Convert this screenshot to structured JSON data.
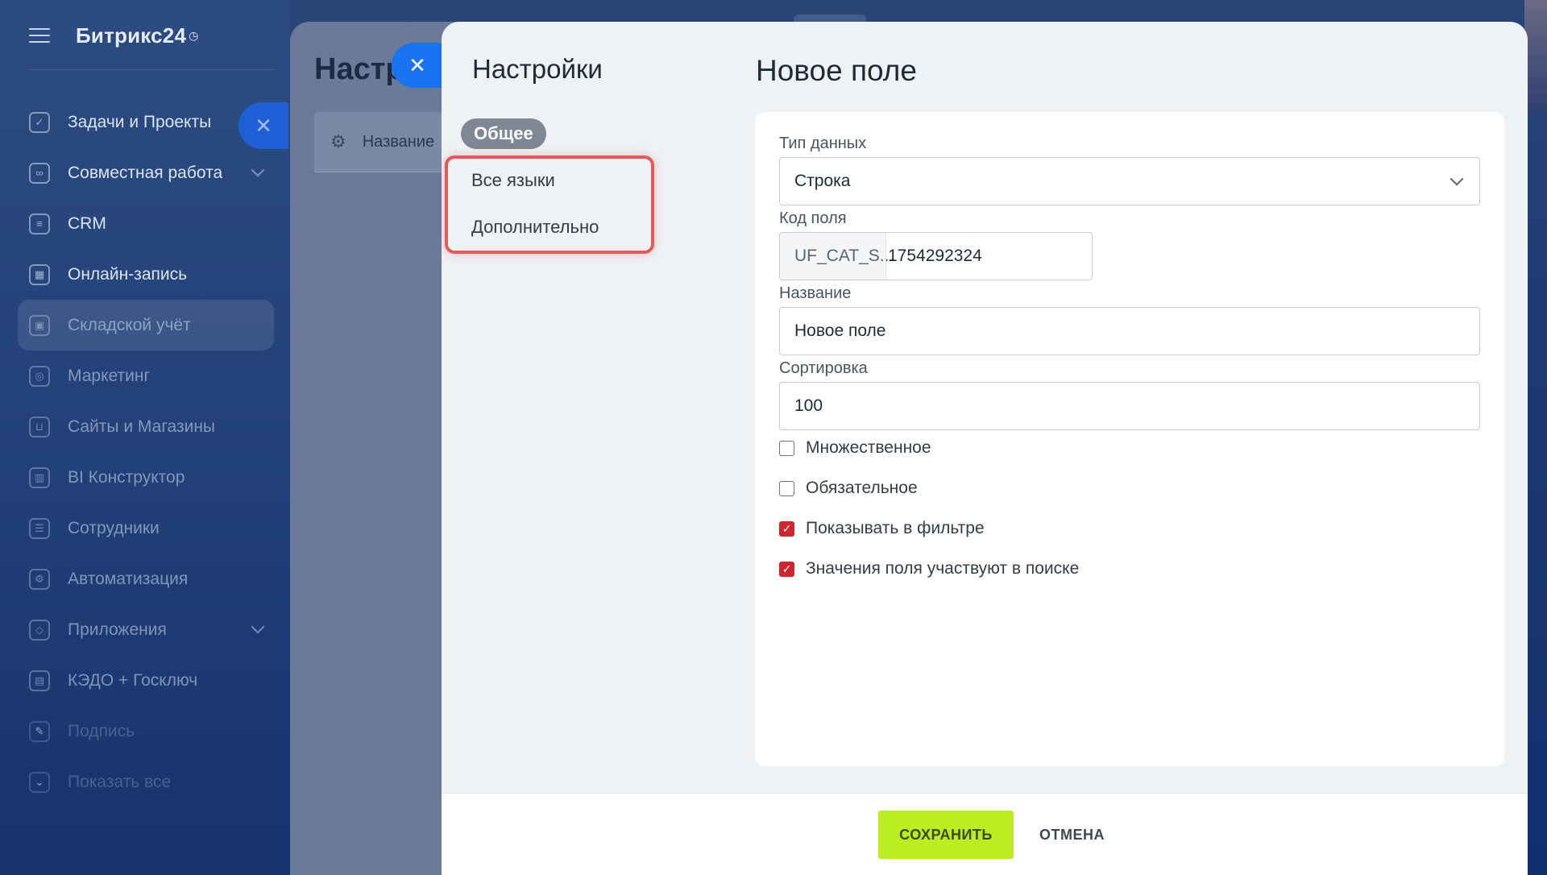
{
  "sidebar": {
    "brand": "Битрикс24",
    "items": [
      {
        "label": "Задачи и Проекты",
        "icon": "checkbox-icon"
      },
      {
        "label": "Совместная работа",
        "icon": "collaboration-icon"
      },
      {
        "label": "CRM",
        "icon": "crm-icon"
      },
      {
        "label": "Онлайн-запись",
        "icon": "calendar-icon"
      },
      {
        "label": "Складской учёт",
        "icon": "warehouse-icon"
      },
      {
        "label": "Маркетинг",
        "icon": "target-icon"
      },
      {
        "label": "Сайты и Магазины",
        "icon": "cart-icon"
      },
      {
        "label": "BI Конструктор",
        "icon": "bar-chart-icon"
      },
      {
        "label": "Сотрудники",
        "icon": "employees-icon"
      },
      {
        "label": "Автоматизация",
        "icon": "robot-icon"
      },
      {
        "label": "Приложения",
        "icon": "cube-icon"
      },
      {
        "label": "КЭДО + Госключ",
        "icon": "document-icon"
      },
      {
        "label": "Подпись",
        "icon": "signature-icon"
      },
      {
        "label": "Показать все",
        "icon": "chevron-down-icon"
      }
    ]
  },
  "background_panel": {
    "title": "Настр",
    "column_label": "Название"
  },
  "settings_nav": {
    "title": "Настройки",
    "active": "Общее",
    "links": [
      "Все языки",
      "Дополнительно"
    ]
  },
  "form": {
    "title": "Новое поле",
    "data_type": {
      "label": "Тип данных",
      "value": "Строка"
    },
    "field_code": {
      "label": "Код поля",
      "prefix": "UF_CAT_S...",
      "value": "1754292324"
    },
    "name": {
      "label": "Название",
      "value": "Новое поле"
    },
    "sort": {
      "label": "Сортировка",
      "value": "100"
    },
    "checkboxes": [
      {
        "label": "Множественное",
        "checked": false
      },
      {
        "label": "Обязательное",
        "checked": false
      },
      {
        "label": "Показывать в фильтре",
        "checked": true
      },
      {
        "label": "Значения поля участвуют в поиске",
        "checked": true
      }
    ]
  },
  "footer": {
    "save_label": "СОХРАНИТЬ",
    "cancel_label": "ОТМЕНА"
  },
  "colors": {
    "accent_save": "#bbed21",
    "checkbox_checked": "#d0242e",
    "highlight_box": "#e25a5a",
    "close_button": "#1a73f0"
  }
}
